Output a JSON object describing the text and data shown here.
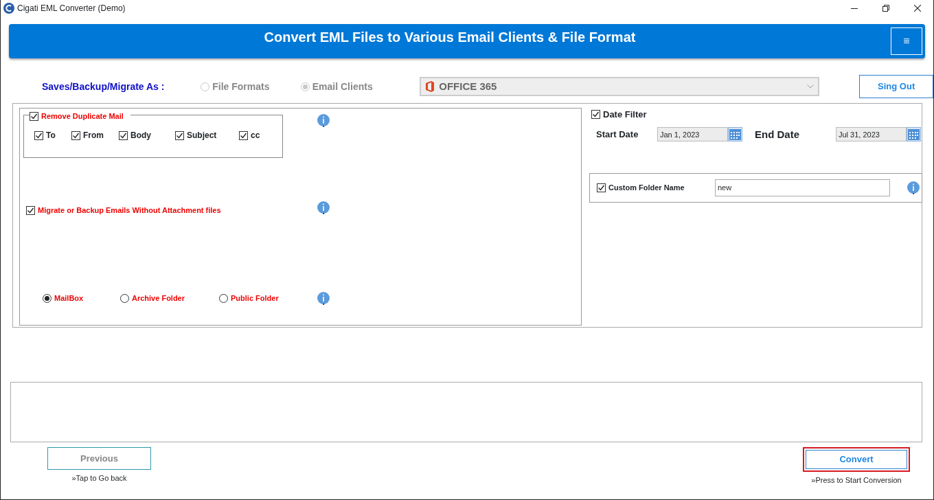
{
  "window": {
    "title": "Cigati EML Converter (Demo)"
  },
  "header": {
    "title": "Convert EML Files to Various Email Clients & File Format",
    "menu_button": "≡"
  },
  "save_as": {
    "label": "Saves/Backup/Migrate As :",
    "options": [
      {
        "label": "File Formats",
        "selected": false,
        "disabled": true
      },
      {
        "label": "Email Clients",
        "selected": true,
        "disabled": true
      }
    ],
    "target": {
      "value": "OFFICE 365"
    }
  },
  "sign_out_button": "Sing Out",
  "remove_duplicates": {
    "label": "Remove Duplicate Mail",
    "checked": true,
    "fields": [
      {
        "label": "To",
        "checked": true
      },
      {
        "label": "From",
        "checked": true
      },
      {
        "label": "Body",
        "checked": true
      },
      {
        "label": "Subject",
        "checked": true
      },
      {
        "label": "cc",
        "checked": true
      }
    ]
  },
  "without_attachments": {
    "label": "Migrate or Backup Emails Without Attachment files",
    "checked": true
  },
  "mailbox_types": [
    {
      "label": "MailBox",
      "selected": true
    },
    {
      "label": "Archive Folder",
      "selected": false
    },
    {
      "label": "Public Folder",
      "selected": false
    }
  ],
  "date_filter": {
    "label": "Date Filter",
    "checked": true,
    "start_label": "Start Date",
    "start_value": "Jan 1, 2023",
    "end_label": "End Date",
    "end_value": "Jul 31, 2023"
  },
  "custom_folder": {
    "label": "Custom Folder Name",
    "checked": true,
    "value": "new"
  },
  "footer": {
    "previous": {
      "label": "Previous",
      "hint": "»Tap to Go back"
    },
    "convert": {
      "label": "Convert",
      "hint": "»Press to Start Conversion"
    }
  }
}
